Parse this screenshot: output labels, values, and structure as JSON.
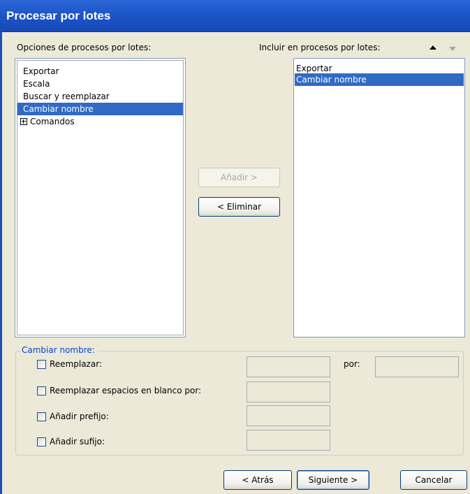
{
  "window": {
    "title": "Procesar por lotes"
  },
  "options_panel": {
    "label": "Opciones de procesos por lotes:",
    "items": [
      "Exportar",
      "Escala",
      "Buscar y reemplazar",
      "Cambiar nombre",
      "Comandos"
    ],
    "selected": "Cambiar nombre"
  },
  "include_panel": {
    "label": "Incluir en procesos por lotes:",
    "items": [
      "Exportar",
      "Cambiar nombre"
    ],
    "selected": "Cambiar nombre"
  },
  "buttons": {
    "add": "Añadir >",
    "remove": "< Eliminar",
    "back": "< Atrás",
    "next": "Siguiente >",
    "cancel": "Cancelar"
  },
  "rename_group": {
    "label": "Cambiar nombre:",
    "replace": "Reemplazar:",
    "replace_with": "por:",
    "replace_spaces": "Reemplazar espacios en blanco por:",
    "add_prefix": "Añadir prefijo:",
    "add_suffix": "Añadir sufijo:",
    "values": {
      "replace": "",
      "replace_with": "",
      "replace_spaces": "",
      "prefix": "",
      "suffix": ""
    },
    "checked": {
      "replace": false,
      "replace_spaces": false,
      "add_prefix": false,
      "add_suffix": false
    }
  },
  "icons": {
    "move_up": "triangle-up-icon",
    "move_down": "triangle-down-icon",
    "expand": "plus-box-icon"
  },
  "colors": {
    "title_bar": "#1d56c9",
    "selection": "#316ac5",
    "group_label": "#0046d5"
  }
}
